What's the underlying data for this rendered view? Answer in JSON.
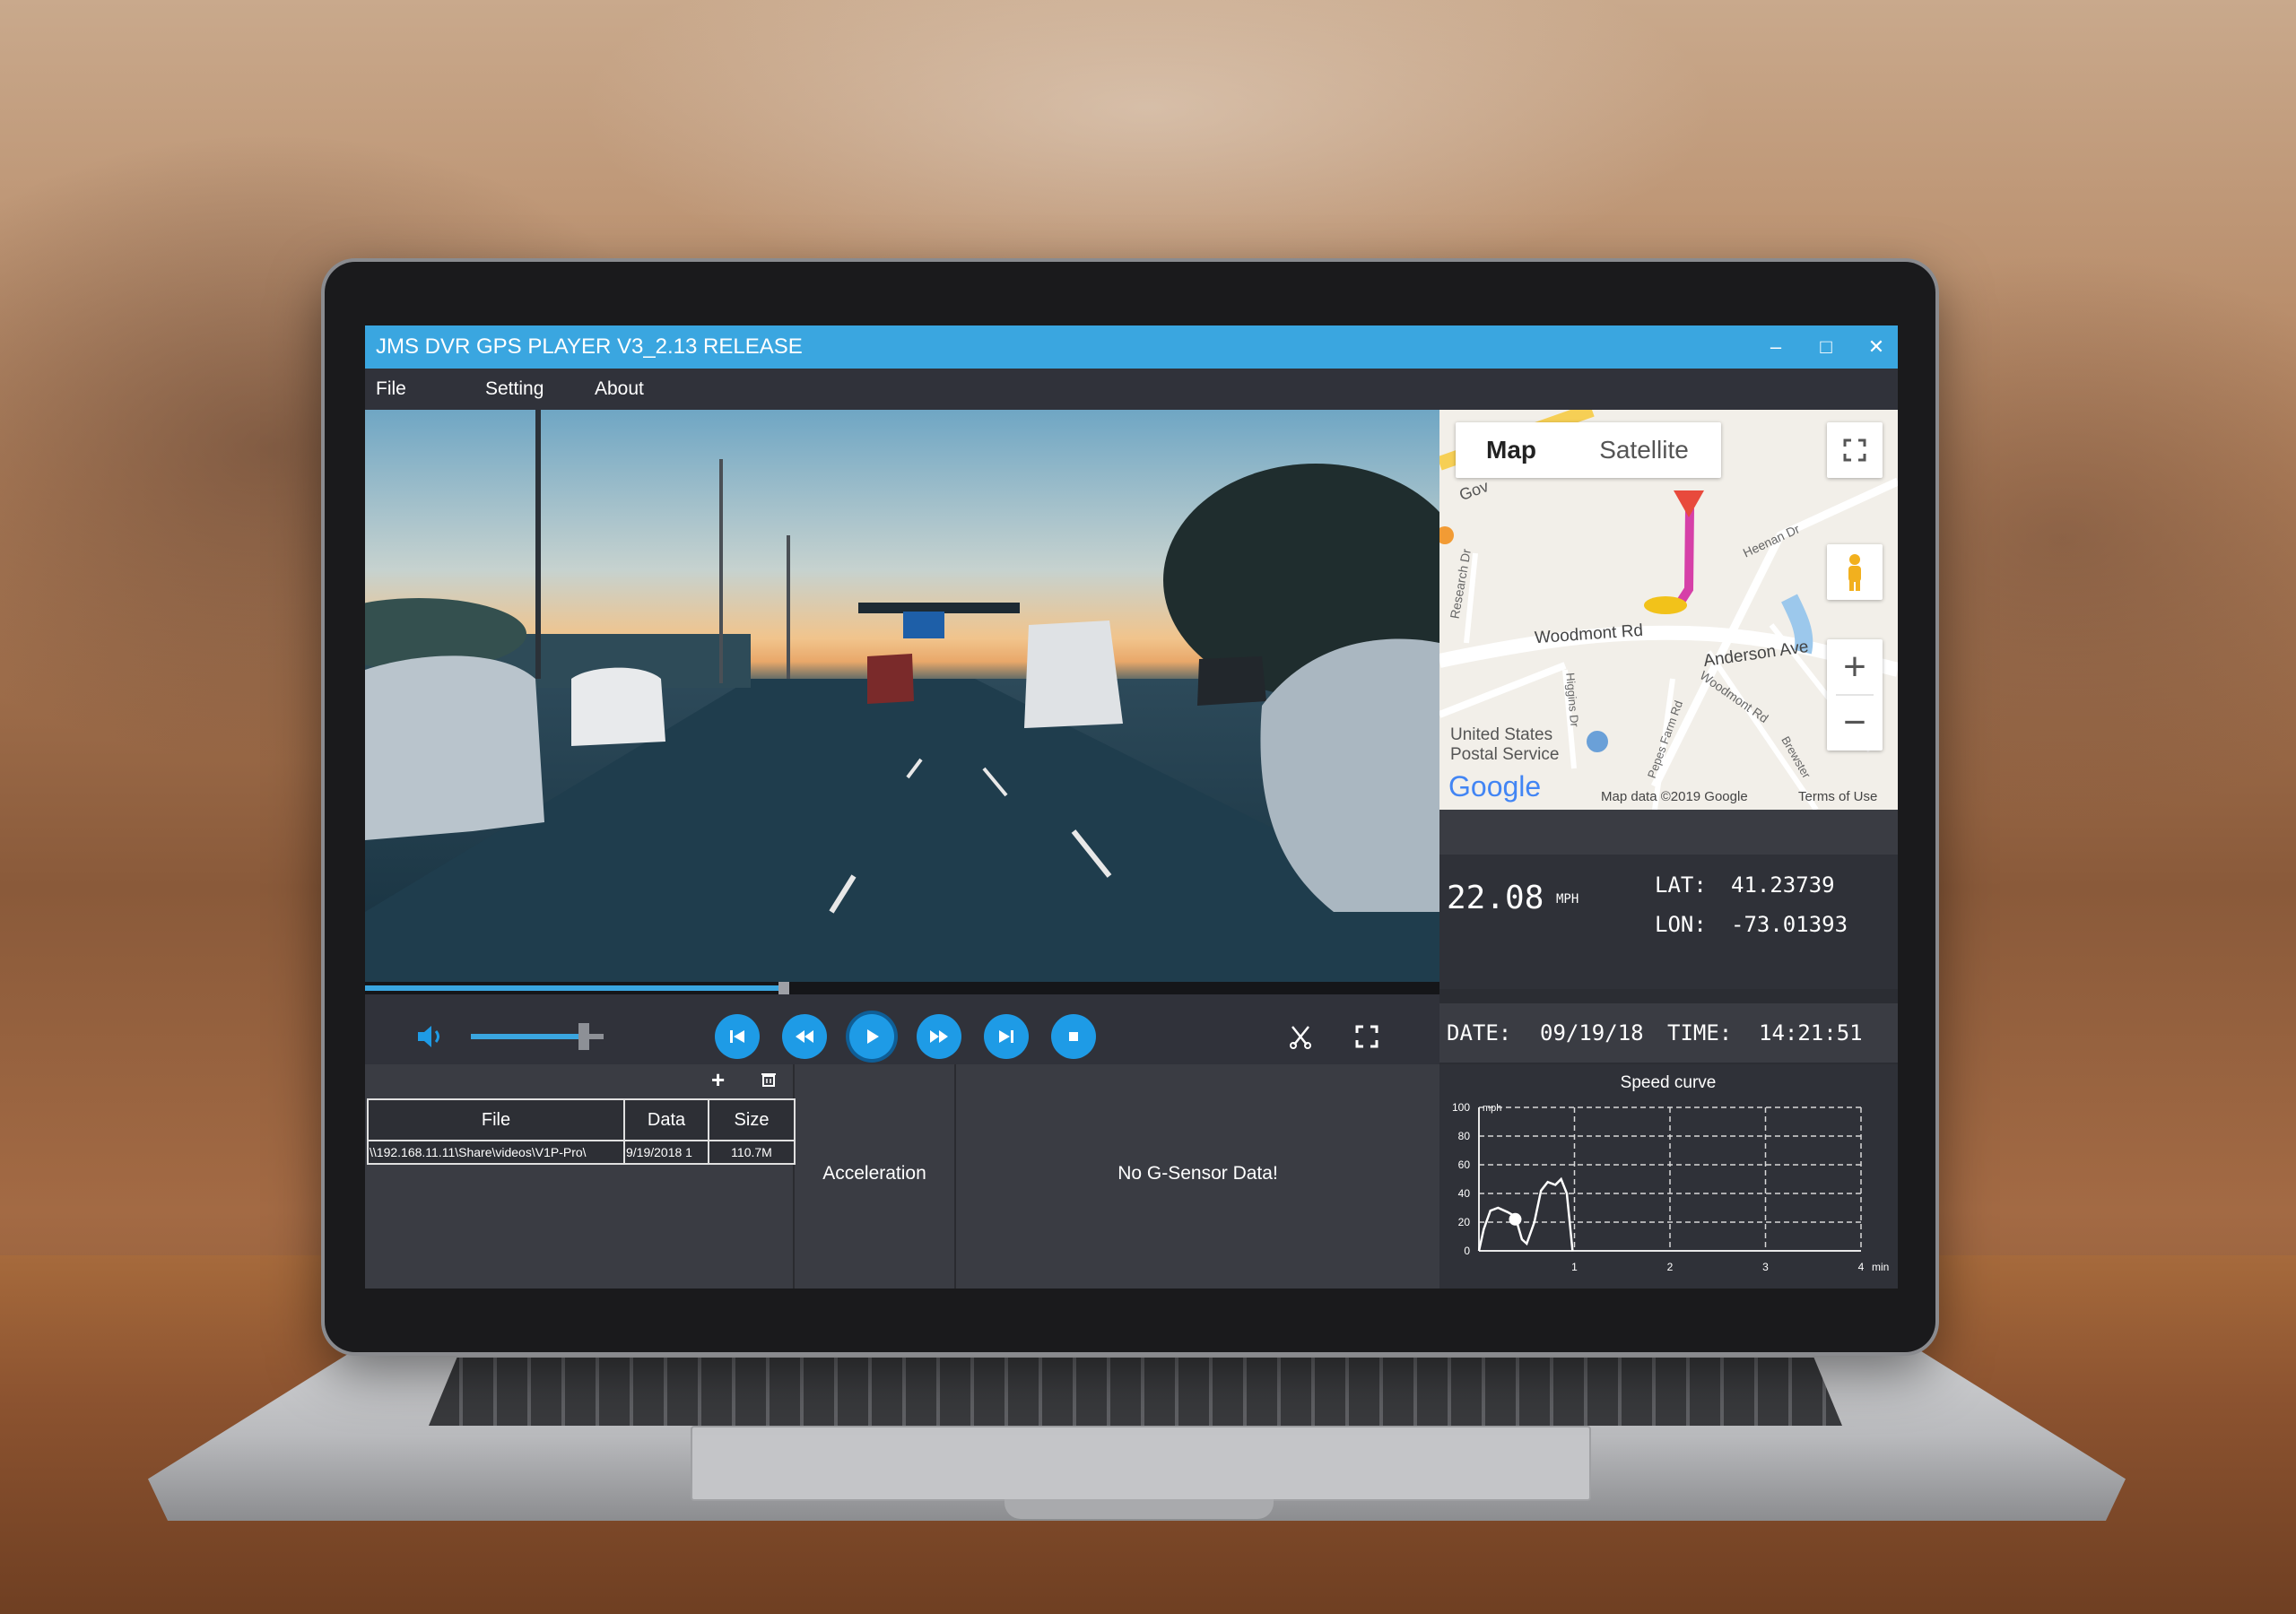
{
  "app": {
    "title": "JMS DVR GPS PLAYER V3_2.13 RELEASE"
  },
  "window_buttons": {
    "minimize": "‒",
    "maximize": "□",
    "close": "✕"
  },
  "menu": [
    {
      "label": "File"
    },
    {
      "label": "Setting"
    },
    {
      "label": "About"
    }
  ],
  "playback": {
    "progress": 0.39,
    "volume": 0.85
  },
  "map": {
    "toggle": [
      {
        "label": "Map"
      },
      {
        "label": "Satellite"
      }
    ],
    "zoom_in": "+",
    "zoom_out": "−",
    "labels": {
      "woodmont": "Woodmont Rd",
      "anderson": "Anderson Ave",
      "usps_1": "United States",
      "usps_2": "Postal Service",
      "research": "Research Dr",
      "heenan": "Heenan Dr",
      "woodmont2": "Woodmont Rd",
      "higgins": "Higgins Dr",
      "pepes": "Pepes Farm Rd",
      "brewster": "Brewster",
      "gov": "Gov"
    },
    "logo": "Google",
    "data_credit": "Map data ©2019 Google",
    "terms": "Terms of Use"
  },
  "gps": {
    "speed_value": "22.08",
    "speed_unit": "MPH",
    "lat_label": "LAT:",
    "lat_value": "41.23739",
    "lon_label": "LON:",
    "lon_value": "-73.01393",
    "date_label": "DATE:",
    "date_value": "09/19/18",
    "time_label": "TIME:",
    "time_value": "14:21:51"
  },
  "file_list": {
    "add_icon": "+",
    "columns": [
      "File",
      "Data",
      "Size"
    ],
    "rows": [
      {
        "file": "\\\\192.168.11.11\\Share\\videos\\V1P-Pro\\",
        "data": "9/19/2018 1",
        "size": "110.7M"
      }
    ]
  },
  "acceleration": {
    "label": "Acceleration",
    "message": "No G-Sensor Data!"
  },
  "chart_data": {
    "type": "line",
    "title": "Speed curve",
    "ylabel": "mph",
    "xlabel": "min",
    "ylim": [
      0,
      100
    ],
    "xlim": [
      0,
      4
    ],
    "yticks": [
      "100",
      "80",
      "60",
      "40",
      "20",
      "0"
    ],
    "xticks": [
      "1",
      "2",
      "3",
      "4"
    ],
    "grid": true,
    "series": [
      {
        "x": [
          0.0,
          0.05,
          0.12,
          0.2,
          0.3,
          0.38,
          0.45,
          0.5,
          0.58,
          0.65,
          0.72,
          0.8,
          0.86,
          0.92,
          0.98
        ],
        "y": [
          0,
          15,
          28,
          30,
          27,
          24,
          8,
          5,
          20,
          42,
          48,
          46,
          50,
          40,
          0
        ]
      }
    ],
    "marker": {
      "x": 0.38,
      "y": 22
    }
  }
}
